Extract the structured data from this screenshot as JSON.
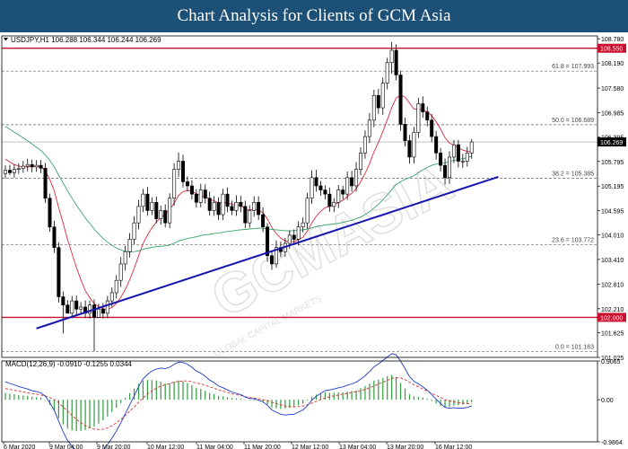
{
  "banner": {
    "title": "Chart Analysis for Clients of GCM Asia"
  },
  "chart_data": {
    "type": "candlestick",
    "symbol_header": "USDJPY,H1  106.288 106.344 106.244 106.269",
    "current_price": 106.269,
    "current_price_label": "106.269",
    "ylim": [
      101.025,
      108.85
    ],
    "price_ticks": [
      "108.780",
      "108.190",
      "107.580",
      "106.985",
      "106.395",
      "105.795",
      "105.195",
      "104.595",
      "104.010",
      "103.410",
      "102.810",
      "102.210",
      "101.625",
      "101.025"
    ],
    "x_ticks": [
      "6 Mar 2020",
      "9 Mar 04:00",
      "9 Mar 20:00",
      "10 Mar 12:00",
      "11 Mar 04:00",
      "11 Mar 20:00",
      "12 Mar 12:00",
      "13 Mar 04:00",
      "13 Mar 20:00",
      "16 Mar 12:00"
    ],
    "horizontal_levels": [
      {
        "value": 108.55,
        "label": "108.550",
        "color": "#c8102e"
      },
      {
        "value": 102.0,
        "label": "102.000",
        "color": "#c8102e"
      }
    ],
    "fibonacci": [
      {
        "ratio": "61.8",
        "value": 107.993,
        "label": "61.8 = 107.993"
      },
      {
        "ratio": "50.0",
        "value": 106.689,
        "label": "50.0 = 106.689"
      },
      {
        "ratio": "38.2",
        "value": 105.385,
        "label": "38.2 = 105.385"
      },
      {
        "ratio": "23.6",
        "value": 103.772,
        "label": "23.6 = 103.772"
      },
      {
        "ratio": "0.0",
        "value": 101.163,
        "label": "0.0 = 101.163"
      }
    ],
    "trendline": {
      "color": "#1515b0",
      "from": [
        7,
        101.73
      ],
      "to": [
        111,
        105.42
      ]
    },
    "close": [
      105.58,
      105.52,
      105.6,
      105.62,
      105.68,
      105.72,
      105.66,
      105.7,
      105.63,
      104.9,
      104.2,
      103.7,
      102.5,
      102.3,
      102.1,
      102.4,
      102.2,
      102.25,
      102.1,
      102.3,
      102.0,
      102.2,
      102.1,
      102.4,
      102.6,
      102.9,
      103.3,
      103.6,
      103.9,
      104.3,
      104.7,
      105.0,
      104.6,
      104.8,
      104.4,
      104.6,
      104.3,
      104.9,
      105.6,
      105.8,
      105.3,
      105.2,
      105.0,
      104.8,
      105.1,
      104.9,
      104.6,
      104.8,
      104.5,
      105.0,
      104.7,
      104.6,
      104.8,
      104.7,
      104.3,
      104.6,
      104.8,
      104.5,
      104.2,
      103.5,
      103.3,
      103.7,
      103.6,
      103.8,
      104.0,
      103.9,
      104.2,
      104.3,
      104.9,
      105.4,
      105.2,
      105.1,
      105.0,
      104.7,
      104.8,
      105.1,
      105.0,
      105.4,
      105.2,
      105.6,
      106.0,
      106.4,
      106.8,
      107.4,
      107.1,
      107.7,
      108.2,
      108.5,
      107.9,
      106.7,
      106.3,
      105.9,
      106.5,
      107.2,
      107.0,
      106.8,
      106.4,
      106.0,
      105.7,
      105.4,
      105.9,
      106.2,
      105.8,
      105.8,
      106.0,
      106.27
    ],
    "open": [
      105.5,
      105.58,
      105.52,
      105.6,
      105.62,
      105.68,
      105.72,
      105.66,
      105.7,
      105.63,
      104.9,
      104.2,
      103.7,
      102.5,
      102.3,
      102.1,
      102.4,
      102.2,
      102.25,
      102.1,
      102.3,
      102.0,
      102.2,
      102.1,
      102.4,
      102.6,
      102.9,
      103.3,
      103.6,
      103.9,
      104.3,
      104.7,
      105.0,
      104.6,
      104.8,
      104.4,
      104.6,
      104.3,
      104.9,
      105.6,
      105.8,
      105.3,
      105.2,
      105.0,
      104.8,
      105.1,
      104.9,
      104.6,
      104.8,
      104.5,
      105.0,
      104.7,
      104.6,
      104.8,
      104.7,
      104.3,
      104.6,
      104.8,
      104.5,
      104.2,
      103.5,
      103.3,
      103.7,
      103.6,
      103.8,
      104.0,
      103.9,
      104.2,
      104.3,
      104.9,
      105.4,
      105.2,
      105.1,
      105.0,
      104.7,
      104.8,
      105.1,
      105.0,
      105.4,
      105.2,
      105.6,
      106.0,
      106.4,
      106.8,
      107.4,
      107.1,
      107.7,
      108.2,
      108.5,
      107.9,
      106.7,
      106.3,
      105.9,
      106.5,
      107.2,
      107.0,
      106.8,
      106.4,
      106.0,
      105.7,
      105.4,
      105.9,
      106.2,
      105.8,
      105.8,
      106.0
    ],
    "high": [
      105.7,
      105.71,
      105.72,
      105.75,
      105.81,
      105.86,
      105.84,
      105.83,
      105.83,
      105.76,
      105.01,
      104.35,
      103.83,
      102.63,
      102.42,
      102.52,
      102.53,
      102.37,
      102.41,
      102.41,
      102.44,
      102.33,
      102.35,
      102.52,
      102.73,
      103.03,
      103.47,
      103.74,
      104.05,
      104.46,
      104.86,
      105.13,
      105.17,
      104.92,
      104.94,
      104.72,
      104.75,
      105.02,
      105.75,
      106.01,
      105.96,
      105.43,
      105.34,
      105.12,
      105.25,
      105.24,
      105.06,
      104.95,
      104.92,
      105.13,
      105.16,
      104.84,
      104.97,
      104.96,
      104.84,
      104.73,
      104.95,
      104.94,
      104.68,
      104.29,
      103.63,
      103.87,
      103.84,
      103.93,
      104.12,
      104.14,
      104.34,
      104.43,
      105.03,
      105.58,
      105.59,
      105.32,
      105.21,
      105.16,
      104.9,
      105.22,
      105.2,
      105.55,
      105.56,
      105.78,
      106.14,
      106.55,
      106.97,
      107.54,
      107.56,
      107.84,
      108.32,
      108.7,
      108.64,
      108.0,
      106.86,
      106.44,
      106.64,
      107.34,
      107.38,
      107.13,
      106.95,
      106.54,
      106.12,
      105.87,
      106.04,
      106.32,
      106.32,
      105.98,
      106.15,
      106.34
    ],
    "low": [
      105.38,
      105.46,
      105.4,
      105.49,
      105.52,
      105.55,
      105.53,
      105.54,
      105.51,
      104.79,
      104.08,
      103.57,
      102.36,
      101.61,
      102.17,
      101.98,
      102.06,
      102.06,
      101.98,
      101.97,
      101.18,
      102.08,
      101.97,
      101.98,
      102.26,
      102.46,
      102.74,
      103.14,
      103.46,
      103.78,
      104.14,
      104.56,
      104.47,
      104.49,
      104.29,
      104.26,
      104.19,
      104.17,
      104.72,
      105.42,
      105.16,
      105.07,
      104.87,
      104.67,
      104.68,
      104.77,
      104.48,
      104.47,
      104.37,
      104.37,
      104.56,
      104.49,
      104.47,
      104.56,
      104.17,
      104.18,
      104.45,
      104.37,
      104.08,
      103.35,
      103.16,
      103.21,
      103.47,
      103.47,
      103.67,
      103.76,
      103.75,
      104.07,
      104.16,
      104.76,
      105.06,
      104.96,
      104.87,
      104.57,
      104.56,
      104.66,
      104.87,
      104.86,
      105.06,
      105.06,
      105.46,
      105.86,
      106.24,
      106.63,
      106.95,
      106.93,
      107.55,
      107.93,
      107.77,
      106.54,
      106.16,
      105.74,
      105.75,
      106.37,
      106.86,
      106.65,
      106.27,
      105.84,
      105.55,
      105.23,
      105.25,
      105.76,
      105.65,
      105.64,
      105.67,
      105.86
    ],
    "moving_averages": [
      {
        "color": "#e0283c",
        "values": [
          105.85,
          105.78,
          105.72,
          105.68,
          105.66,
          105.66,
          105.67,
          105.68,
          105.67,
          105.56,
          105.36,
          105.08,
          104.67,
          104.29,
          103.89,
          103.55,
          103.21,
          102.91,
          102.65,
          102.48,
          102.33,
          102.26,
          102.21,
          102.19,
          102.24,
          102.34,
          102.49,
          102.68,
          102.92,
          103.19,
          103.5,
          103.8,
          104.0,
          104.18,
          104.32,
          104.43,
          104.51,
          104.62,
          104.78,
          104.97,
          105.06,
          105.09,
          105.07,
          105.01,
          104.97,
          104.94,
          104.87,
          104.84,
          104.78,
          104.79,
          104.79,
          104.75,
          104.73,
          104.72,
          104.64,
          104.61,
          104.63,
          104.61,
          104.55,
          104.39,
          104.19,
          104.04,
          103.93,
          103.86,
          103.84,
          103.84,
          103.89,
          103.95,
          104.1,
          104.3,
          104.46,
          104.58,
          104.67,
          104.7,
          104.73,
          104.8,
          104.85,
          104.94,
          105.02,
          105.13,
          105.3,
          105.5,
          105.74,
          106.03,
          106.26,
          106.52,
          106.81,
          107.11,
          107.34,
          107.41,
          107.36,
          107.22,
          107.07,
          107.07,
          107.05,
          107.0,
          106.91,
          106.76,
          106.58,
          106.37,
          106.24,
          106.19,
          106.13,
          106.07,
          106.04,
          106.03
        ]
      },
      {
        "color": "#3aa36a",
        "values": [
          106.65,
          106.58,
          106.51,
          106.44,
          106.37,
          106.3,
          106.22,
          106.14,
          106.06,
          105.95,
          105.82,
          105.66,
          105.46,
          105.27,
          105.08,
          104.9,
          104.73,
          104.57,
          104.42,
          104.29,
          104.15,
          104.03,
          103.92,
          103.83,
          103.75,
          103.69,
          103.64,
          103.61,
          103.59,
          103.6,
          103.62,
          103.66,
          103.68,
          103.7,
          103.72,
          103.73,
          103.74,
          103.76,
          103.81,
          103.86,
          103.89,
          103.92,
          103.94,
          103.96,
          103.99,
          104.01,
          104.02,
          104.04,
          104.05,
          104.07,
          104.09,
          104.1,
          104.12,
          104.13,
          104.14,
          104.15,
          104.16,
          104.17,
          104.17,
          104.16,
          104.14,
          104.13,
          104.12,
          104.11,
          104.11,
          104.11,
          104.12,
          104.13,
          104.15,
          104.18,
          104.21,
          104.23,
          104.25,
          104.26,
          104.27,
          104.29,
          104.31,
          104.34,
          104.36,
          104.4,
          104.44,
          104.5,
          104.57,
          104.66,
          104.75,
          104.86,
          104.98,
          105.11,
          105.23,
          105.3,
          105.36,
          105.4,
          105.45,
          105.52,
          105.59,
          105.65,
          105.7,
          105.73,
          105.75,
          105.76,
          105.79,
          105.82,
          105.84,
          105.86,
          105.89,
          105.92
        ]
      }
    ],
    "macd": {
      "label": "MACD(12,26,9) -0.0910 -0.1255 0.0344",
      "axis_ticks": [
        "0.9065",
        "0.00",
        "-0.9864"
      ],
      "ylim": [
        -0.9864,
        0.9065
      ],
      "histogram_color": "#2e9e3e",
      "signal_color": "#d83030",
      "macd_color": "#1e3cc8",
      "histogram": [
        0.16,
        0.14,
        0.13,
        0.11,
        0.1,
        0.09,
        0.07,
        0.06,
        0.05,
        -0.01,
        -0.12,
        -0.25,
        -0.43,
        -0.58,
        -0.68,
        -0.72,
        -0.74,
        -0.73,
        -0.71,
        -0.67,
        -0.63,
        -0.56,
        -0.48,
        -0.39,
        -0.29,
        -0.19,
        -0.08,
        0.04,
        0.15,
        0.26,
        0.37,
        0.45,
        0.46,
        0.46,
        0.45,
        0.42,
        0.38,
        0.38,
        0.42,
        0.45,
        0.43,
        0.39,
        0.34,
        0.28,
        0.25,
        0.21,
        0.16,
        0.13,
        0.09,
        0.08,
        0.06,
        0.04,
        0.03,
        0.02,
        -0.01,
        -0.02,
        -0.02,
        -0.03,
        -0.05,
        -0.11,
        -0.18,
        -0.2,
        -0.22,
        -0.21,
        -0.19,
        -0.17,
        -0.13,
        -0.09,
        -0.02,
        0.07,
        0.12,
        0.15,
        0.17,
        0.16,
        0.16,
        0.17,
        0.17,
        0.19,
        0.2,
        0.22,
        0.27,
        0.32,
        0.38,
        0.45,
        0.47,
        0.51,
        0.55,
        0.58,
        0.53,
        0.39,
        0.26,
        0.13,
        0.08,
        0.07,
        0.05,
        0.02,
        -0.03,
        -0.09,
        -0.14,
        -0.18,
        -0.17,
        -0.14,
        -0.13,
        -0.12,
        -0.09,
        -0.06
      ],
      "signal": [
        0.26,
        0.24,
        0.22,
        0.2,
        0.18,
        0.16,
        0.14,
        0.13,
        0.11,
        0.09,
        0.05,
        0.0,
        -0.07,
        -0.17,
        -0.27,
        -0.37,
        -0.46,
        -0.54,
        -0.61,
        -0.66,
        -0.69,
        -0.7,
        -0.69,
        -0.66,
        -0.61,
        -0.54,
        -0.46,
        -0.37,
        -0.27,
        -0.17,
        -0.06,
        0.04,
        0.13,
        0.21,
        0.27,
        0.32,
        0.35,
        0.38,
        0.41,
        0.43,
        0.44,
        0.44,
        0.42,
        0.39,
        0.37,
        0.34,
        0.3,
        0.27,
        0.23,
        0.2,
        0.17,
        0.14,
        0.12,
        0.1,
        0.07,
        0.05,
        0.04,
        0.02,
        0.0,
        -0.02,
        -0.06,
        -0.09,
        -0.12,
        -0.15,
        -0.16,
        -0.17,
        -0.16,
        -0.15,
        -0.12,
        -0.08,
        -0.04,
        0.0,
        0.04,
        0.07,
        0.09,
        0.11,
        0.13,
        0.15,
        0.17,
        0.19,
        0.21,
        0.24,
        0.28,
        0.32,
        0.37,
        0.41,
        0.45,
        0.5,
        0.52,
        0.51,
        0.47,
        0.41,
        0.35,
        0.3,
        0.25,
        0.2,
        0.15,
        0.1,
        0.05,
        0.0,
        -0.03,
        -0.05,
        -0.07,
        -0.08,
        -0.09,
        -0.09
      ],
      "macd_line": [
        0.42,
        0.38,
        0.35,
        0.31,
        0.28,
        0.25,
        0.21,
        0.19,
        0.16,
        0.08,
        -0.07,
        -0.25,
        -0.5,
        -0.75,
        -0.95,
        -1.09,
        -1.2,
        -1.27,
        -1.32,
        -1.33,
        -1.32,
        -1.26,
        -1.17,
        -1.05,
        -0.9,
        -0.73,
        -0.54,
        -0.33,
        -0.12,
        0.09,
        0.31,
        0.49,
        0.59,
        0.67,
        0.72,
        0.74,
        0.73,
        0.76,
        0.83,
        0.88,
        0.87,
        0.83,
        0.76,
        0.67,
        0.62,
        0.55,
        0.46,
        0.4,
        0.32,
        0.28,
        0.23,
        0.18,
        0.15,
        0.12,
        0.06,
        0.03,
        0.02,
        -0.01,
        -0.05,
        -0.13,
        -0.24,
        -0.29,
        -0.34,
        -0.36,
        -0.35,
        -0.34,
        -0.29,
        -0.24,
        -0.14,
        -0.01,
        0.08,
        0.15,
        0.21,
        0.23,
        0.25,
        0.28,
        0.3,
        0.34,
        0.37,
        0.41,
        0.48,
        0.56,
        0.66,
        0.77,
        0.84,
        0.92,
        1.0,
        1.08,
        1.05,
        0.9,
        0.73,
        0.54,
        0.43,
        0.37,
        0.3,
        0.22,
        0.12,
        0.01,
        -0.09,
        -0.18,
        -0.2,
        -0.19,
        -0.2,
        -0.2,
        -0.18,
        -0.15
      ]
    },
    "watermark": {
      "text": "GCMASIA",
      "small": "GLOBAL CAPITAL MARKETS"
    }
  }
}
